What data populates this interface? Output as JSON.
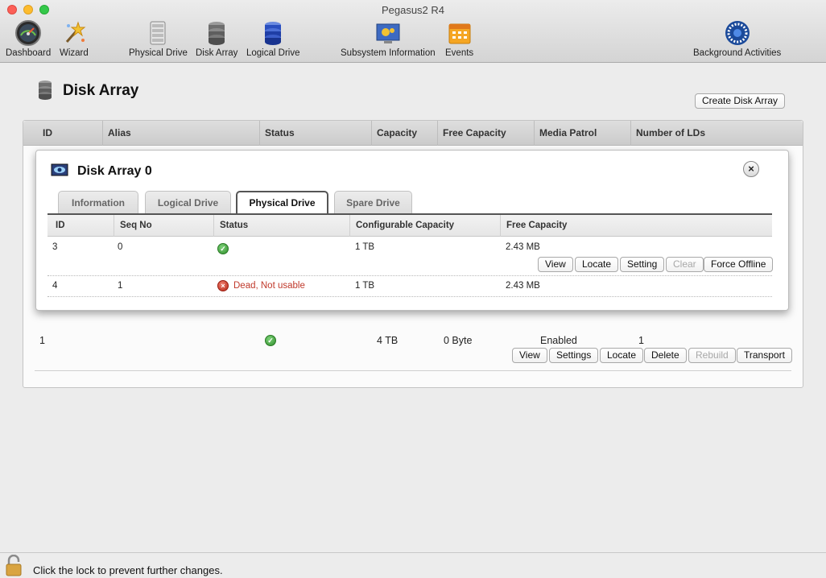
{
  "window": {
    "title": "Pegasus2 R4"
  },
  "toolbar": {
    "dashboard": "Dashboard",
    "wizard": "Wizard",
    "physical_drive": "Physical Drive",
    "disk_array": "Disk Array",
    "logical_drive": "Logical Drive",
    "subsystem_information": "Subsystem Information",
    "events": "Events",
    "background_activities": "Background Activities"
  },
  "page": {
    "title": "Disk Array",
    "create_button": "Create Disk Array"
  },
  "array_table": {
    "columns": [
      "ID",
      "Alias",
      "Status",
      "Capacity",
      "Free Capacity",
      "Media Patrol",
      "Number of LDs"
    ],
    "row": {
      "id": "1",
      "alias": "",
      "status_icon": "check-icon",
      "capacity": "4 TB",
      "free_capacity": "0 Byte",
      "media_patrol": "Enabled",
      "number_of_lds": "1",
      "actions": [
        "View",
        "Settings",
        "Locate",
        "Delete",
        "Rebuild",
        "Transport"
      ]
    }
  },
  "popup": {
    "title": "Disk Array 0",
    "tabs": [
      "Information",
      "Logical Drive",
      "Physical Drive",
      "Spare Drive"
    ],
    "active_tab": "Physical Drive",
    "columns": [
      "ID",
      "Seq No",
      "Status",
      "Configurable Capacity",
      "Free Capacity"
    ],
    "rows": [
      {
        "id": "3",
        "seq_no": "0",
        "status_icon": "check-icon",
        "status_text": "",
        "configurable_capacity": "1 TB",
        "free_capacity": "2.43 MB",
        "actions": [
          "View",
          "Locate",
          "Setting",
          "Clear",
          "Force Offline"
        ]
      },
      {
        "id": "4",
        "seq_no": "1",
        "status_icon": "error-icon",
        "status_text": "Dead, Not usable",
        "configurable_capacity": "1 TB",
        "free_capacity": "2.43 MB",
        "actions": []
      }
    ]
  },
  "footer": {
    "lock_text": "Click the lock to prevent further changes."
  },
  "colors": {
    "dead_text": "#c0392b",
    "ok_icon": "#2f8d2b",
    "error_icon": "#b52616"
  }
}
